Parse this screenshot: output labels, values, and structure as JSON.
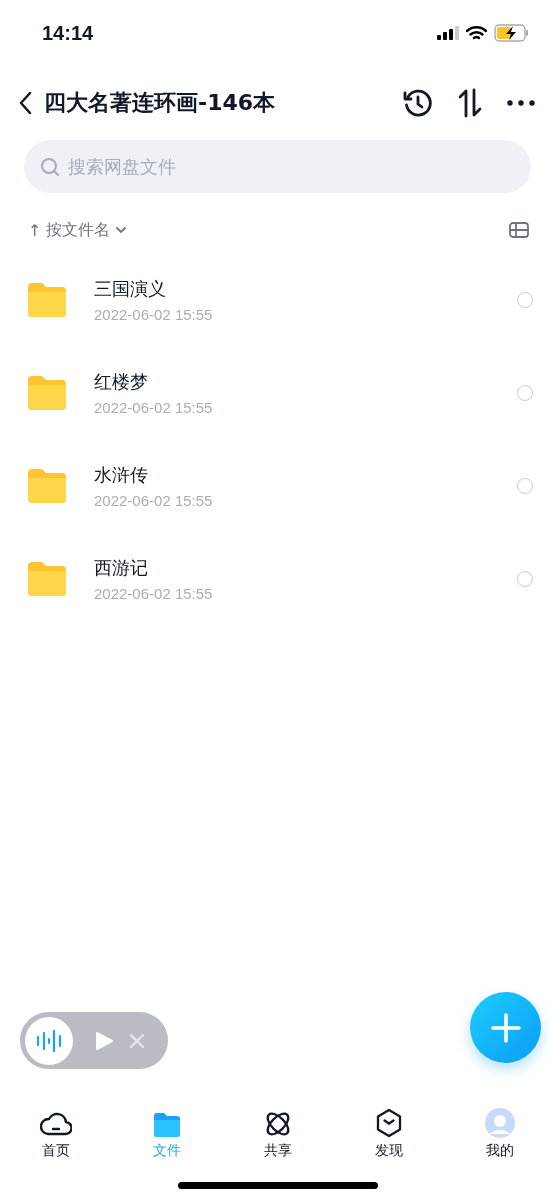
{
  "status_bar": {
    "time": "14:14",
    "charging": true
  },
  "header": {
    "title": "四大名著连环画-146本"
  },
  "search": {
    "placeholder": "搜索网盘文件"
  },
  "sort": {
    "arrow": "↑",
    "label": "按文件名"
  },
  "files": [
    {
      "name": "三国演义",
      "date": "2022-06-02 15:55",
      "selected": false
    },
    {
      "name": "红楼梦",
      "date": "2022-06-02 15:55",
      "selected": false
    },
    {
      "name": "水浒传",
      "date": "2022-06-02 15:55",
      "selected": false
    },
    {
      "name": "西游记",
      "date": "2022-06-02 15:55",
      "selected": false
    }
  ],
  "tabs": [
    {
      "label": "首页",
      "kind": "home",
      "selected": false
    },
    {
      "label": "文件",
      "kind": "files",
      "selected": true
    },
    {
      "label": "共享",
      "kind": "share",
      "selected": false
    },
    {
      "label": "发现",
      "kind": "discover",
      "selected": false
    },
    {
      "label": "我的",
      "kind": "me",
      "selected": false
    }
  ]
}
